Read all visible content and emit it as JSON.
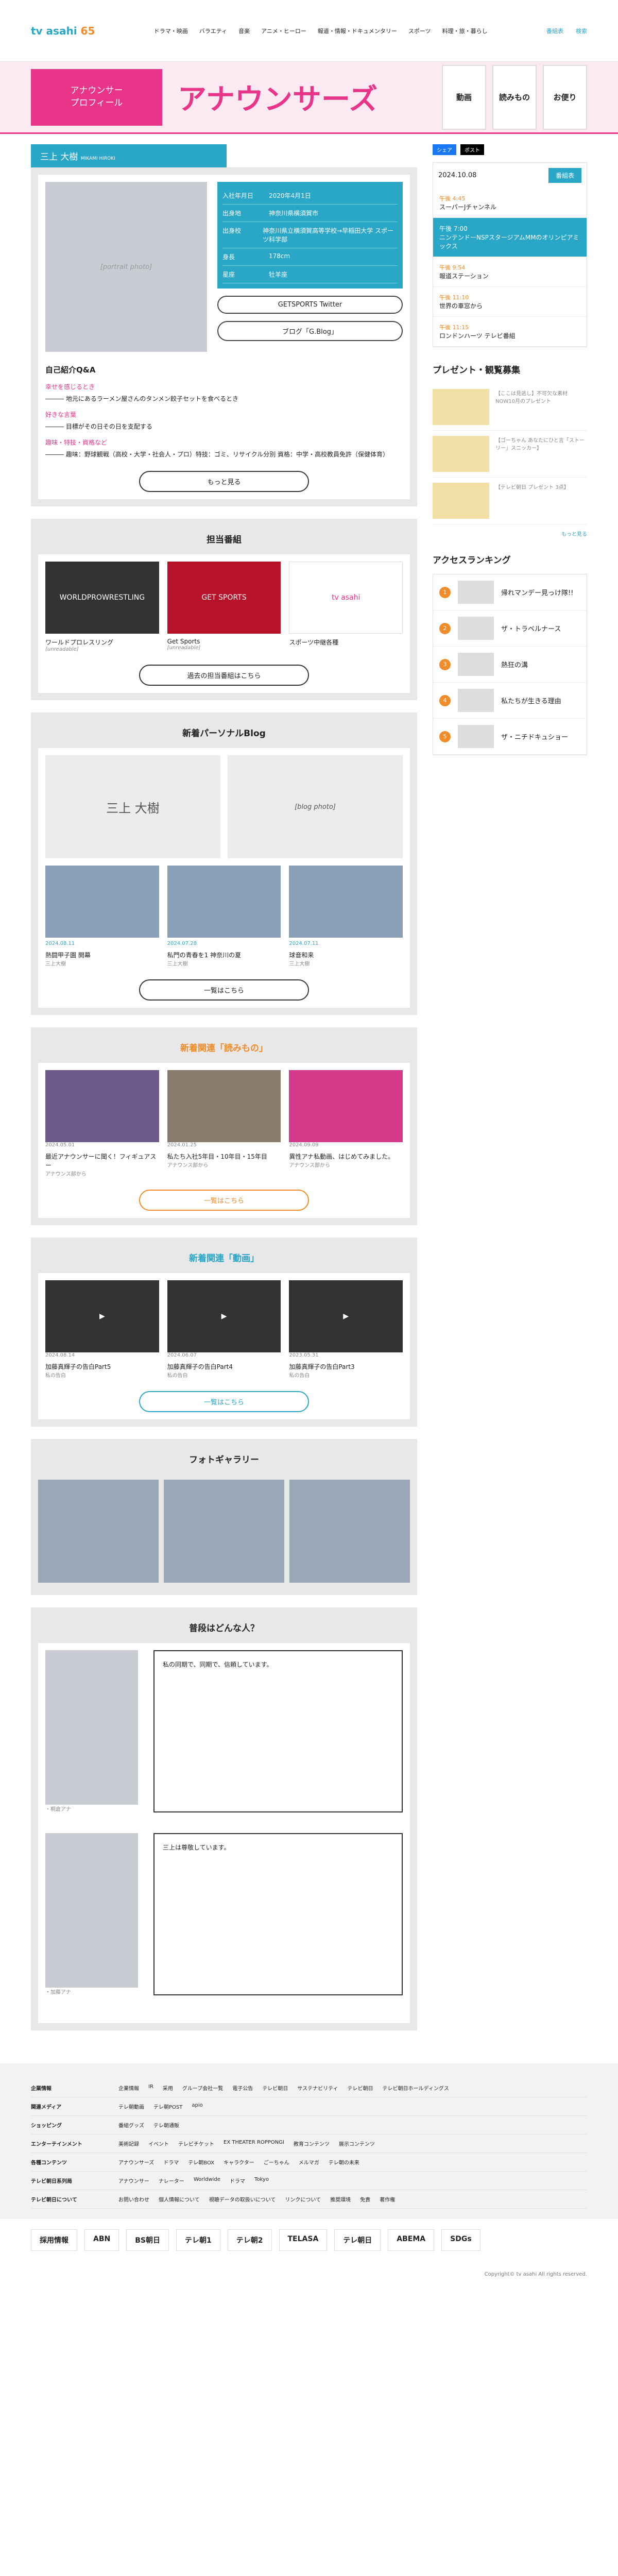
{
  "header": {
    "logo": "tv asahi",
    "logo_sub": "65",
    "nav": [
      "ドラマ・映画",
      "バラエティ",
      "音楽",
      "アニメ・ヒーロー",
      "報道・情報・ドキュメンタリー",
      "スポーツ",
      "料理・旅・暮らし"
    ],
    "icons": [
      "番組表",
      "検索"
    ]
  },
  "banner": {
    "profile_label": "アナウンサー\nプロフィール",
    "title": "アナウンサーズ",
    "boxes": [
      "動画",
      "読みもの",
      "お便り"
    ]
  },
  "profile": {
    "name": "三上 大樹",
    "name_en": "MIKAMI HIROKI",
    "portrait_alt": "[portrait photo]",
    "rows": [
      {
        "k": "入社年月日",
        "v": "2020年4月1日"
      },
      {
        "k": "出身地",
        "v": "神奈川県横須賀市"
      },
      {
        "k": "出身校",
        "v": "神奈川県立横須賀高等学校→早稲田大学 スポーツ科学部"
      },
      {
        "k": "身長",
        "v": "178cm"
      },
      {
        "k": "星座",
        "v": "牡羊座"
      }
    ],
    "btn_twitter": "GETSPORTS Twitter",
    "btn_blog": "ブログ「G.Blog」"
  },
  "qa": {
    "title": "自己紹介Q&A",
    "items": [
      {
        "q": "幸せを感じるとき",
        "a": "――― 地元にあるラーメン屋さんのタンメン餃子セットを食べるとき"
      },
      {
        "q": "好きな言葉",
        "a": "――― 目標がその日その日を支配する"
      },
      {
        "q": "趣味・特技・資格など",
        "a": "――― 趣味：野球観戦（高校・大学・社会人・プロ）特技：ゴミ、リサイクル分別 資格：中学・高校教員免許（保健体育）"
      }
    ],
    "more": "もっと見る"
  },
  "shows": {
    "title": "担当番組",
    "items": [
      {
        "name": "ワールドプロレスリング",
        "thumb": "WORLDPROWRESTLING",
        "time": "[unreadable]"
      },
      {
        "name": "Get Sports",
        "thumb": "GET SPORTS",
        "time": "[unreadable]"
      },
      {
        "name": "スポーツ中継各種",
        "thumb": "tv asahi",
        "time": ""
      }
    ],
    "past": "過去の担当番組はこちら"
  },
  "blog": {
    "title": "新着パーソナルBlog",
    "top": [
      "三上 大樹",
      "[blog photo]"
    ],
    "items": [
      {
        "date": "2024.08.11",
        "title": "熱闘甲子園 開幕",
        "author": "三上大樹"
      },
      {
        "date": "2024.07.28",
        "title": "私門の青春を1 神奈川の夏",
        "author": "三上大樹"
      },
      {
        "date": "2024.07.11",
        "title": "球音和来",
        "author": "三上大樹"
      }
    ],
    "more": "一覧はこちら"
  },
  "reads": {
    "title": "新着関連「読みもの」",
    "items": [
      {
        "date": "2024.05.01",
        "title": "最近アナウンサーに聞く！フィギュアスー",
        "tag": "アナウンス部から"
      },
      {
        "date": "2024.01.25",
        "title": "私たち入社5年目・10年目・15年目",
        "tag": "アナウンス部から"
      },
      {
        "date": "2024.09.09",
        "title": "異性アナ私動画、はじめてみました。",
        "tag": "アナウンス部から"
      }
    ],
    "more": "一覧はこちら"
  },
  "videos": {
    "title": "新着関連「動画」",
    "items": [
      {
        "date": "2024.08.14",
        "title": "加藤真輝子の告白Part5",
        "tag": "私の告白"
      },
      {
        "date": "2024.06.07",
        "title": "加藤真輝子の告白Part4",
        "tag": "私の告白"
      },
      {
        "date": "2023.05.31",
        "title": "加藤真輝子の告白Part3",
        "tag": "私の告白"
      }
    ],
    "more": "一覧はこちら"
  },
  "gallery": {
    "title": "フォトギャラリー"
  },
  "people": {
    "title": "普段はどんな人？",
    "items": [
      {
        "name": "・桐倉アナ",
        "text": "私の同期で、同期で、信頼しています。"
      },
      {
        "name": "・加藤アナ",
        "text": "三上は尊敬しています。"
      }
    ]
  },
  "sidebar": {
    "share": [
      "シェア",
      "ポスト"
    ],
    "date": "2024.10.08",
    "tv_btn": "番組表",
    "schedule": [
      {
        "time": "午後 4:45",
        "title": "スーパーJチャンネル",
        "active": false
      },
      {
        "time": "午後 7:00",
        "title": "ニンテンドーNSPスタージアムMMのオリンピアミックス",
        "active": true
      },
      {
        "time": "午後 9:54",
        "title": "報道ステーション",
        "active": false
      },
      {
        "time": "午後 11:10",
        "title": "世界の車窓から",
        "active": false
      },
      {
        "time": "午後 11:15",
        "title": "ロンドンハーツ テレビ番組 ",
        "active": false
      }
    ],
    "present_title": "プレゼント・観覧募集",
    "presents": [
      "【ここは見逃し】不可欠な素材 NOW10月のプレゼント",
      "【ゴーちゃん あなたにひと言「ストーリー」スニッカー】",
      "【テレビ朝日 プレゼント 3点】"
    ],
    "more": "もっと見る",
    "rank_title": "アクセスランキング",
    "ranks": [
      "帰れマンデー見っけ隊!!",
      "ザ・トラベルナース",
      "熱狂の溝",
      "私たちが生きる理由",
      "ザ・ニチドキュショー"
    ]
  },
  "footer": {
    "rows": [
      {
        "k": "企業情報",
        "v": [
          "企業情報",
          "IR",
          "采用",
          "グループ会社一覧",
          "電子公告",
          "テレビ朝日",
          "サステナビリティ",
          "テレビ朝日",
          "テレビ朝日ホールディングス"
        ]
      },
      {
        "k": "関連メディア",
        "v": [
          "テレ朝動画",
          "テレ朝POST",
          "apio"
        ]
      },
      {
        "k": "ショッピング",
        "v": [
          "番組グッズ",
          "テレ朝通販"
        ]
      },
      {
        "k": "エンターテインメント",
        "v": [
          "美術記録",
          "イベント",
          "テレビチケット",
          "EX THEATER ROPPONGI",
          "教育コンテンツ",
          "展示コンテンツ"
        ]
      },
      {
        "k": "各種コンテンツ",
        "v": [
          "アナウンサーズ",
          "ドラマ",
          "テレ朝BOX",
          "キャラクター",
          "ごーちゃん",
          "メルマガ",
          "テレ朝の未来"
        ]
      },
      {
        "k": "テレビ朝日系列局",
        "v": [
          "アナウンサー",
          "ナレーター",
          "Worldwide",
          "ドラマ",
          "Tokyo"
        ]
      },
      {
        "k": "テレビ朝日について",
        "v": [
          "お問い合わせ",
          "個人情報について",
          "視聴データの取扱いについて",
          "リンクについて",
          "推奨環境",
          "免責",
          "著作権"
        ]
      }
    ],
    "partners": [
      "採用情報",
      "ABN",
      "BS朝日",
      "テレ朝1",
      "テレ朝2",
      "TELASA",
      "テレ朝日",
      "ABEMA",
      "SDGs"
    ],
    "copyright": "Copyright© tv asahi All rights reserved."
  }
}
